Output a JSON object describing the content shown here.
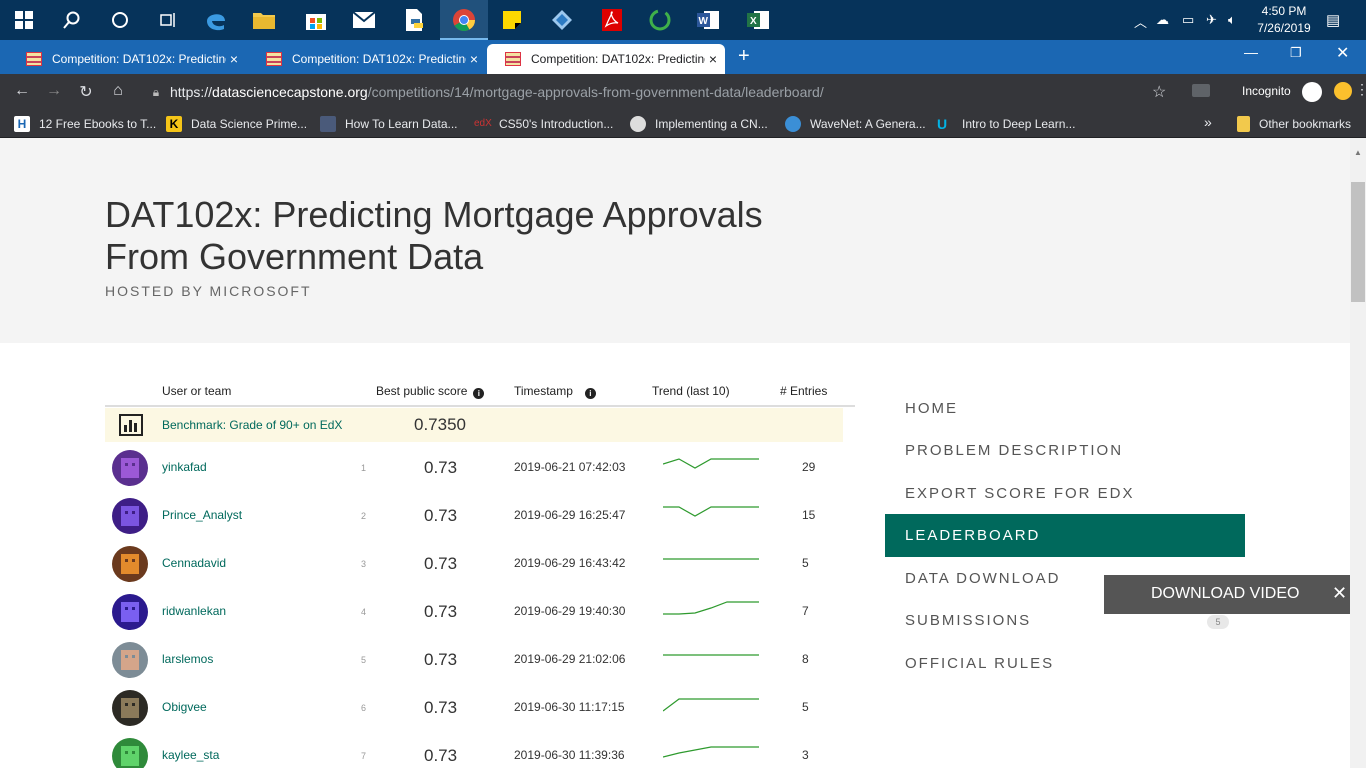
{
  "taskbar": {
    "time": "4:50 PM",
    "date": "7/26/2019"
  },
  "tabs": [
    {
      "title": "Competition: DAT102x: Predicting Mortgage Approvals",
      "close": "×"
    },
    {
      "title": "Competition: DAT102x: Predicting Mortgage Approvals",
      "close": "×"
    },
    {
      "title": "Competition: DAT102x: Predicting Mortgage Approvals",
      "close": "×"
    }
  ],
  "toolbar": {
    "new_tab": "+",
    "url_scheme": "https://",
    "url_host": "datasciencecapstone.org",
    "url_path": "/competitions/14/mortgage-approvals-from-government-data/leaderboard/",
    "incognito_label": "Incognito"
  },
  "bookmarks": {
    "items": [
      {
        "label": "12 Free Ebooks to T..."
      },
      {
        "label": "Data Science Prime..."
      },
      {
        "label": "How To Learn Data..."
      },
      {
        "label": "CS50's Introduction..."
      },
      {
        "label": "Implementing a CN..."
      },
      {
        "label": "WaveNet: A Genera..."
      },
      {
        "label": "Intro to Deep Learn..."
      }
    ],
    "overflow": "»",
    "other": "Other bookmarks"
  },
  "hero": {
    "title_line1": "DAT102x: Predicting Mortgage Approvals",
    "title_line2": "From Government Data",
    "hosted_by": "HOSTED BY MICROSOFT"
  },
  "leaderboard": {
    "columns": {
      "user": "User or team",
      "score": "Best public score",
      "timestamp": "Timestamp",
      "trend": "Trend (last 10)",
      "entries": "# Entries"
    },
    "benchmark": {
      "name": "Benchmark: Grade of 90+ on EdX",
      "score": "0.7350"
    },
    "rows": [
      {
        "rank": "1",
        "name": "yinkafad",
        "score": "0.73",
        "timestamp": "2019-06-21 07:42:03",
        "entries": "29",
        "trend": [
          0.55,
          0.35,
          0.7,
          0.35,
          0.35,
          0.35,
          0.35
        ]
      },
      {
        "rank": "2",
        "name": "Prince_Analyst",
        "score": "0.73",
        "timestamp": "2019-06-29 16:25:47",
        "entries": "15",
        "trend": [
          0.35,
          0.35,
          0.7,
          0.35,
          0.35,
          0.35,
          0.35
        ]
      },
      {
        "rank": "3",
        "name": "Cennadavid",
        "score": "0.73",
        "timestamp": "2019-06-29 16:43:42",
        "entries": "5",
        "trend": [
          0.5,
          0.5,
          0.5,
          0.5,
          0.5,
          0.5,
          0.5
        ]
      },
      {
        "rank": "4",
        "name": "ridwanlekan",
        "score": "0.73",
        "timestamp": "2019-06-29 19:40:30",
        "entries": "7",
        "trend": [
          0.8,
          0.8,
          0.75,
          0.55,
          0.3,
          0.3,
          0.3
        ]
      },
      {
        "rank": "5",
        "name": "larslemos",
        "score": "0.73",
        "timestamp": "2019-06-29 21:02:06",
        "entries": "8",
        "trend": [
          0.5,
          0.5,
          0.5,
          0.5,
          0.5,
          0.5,
          0.5
        ]
      },
      {
        "rank": "6",
        "name": "Obigvee",
        "score": "0.73",
        "timestamp": "2019-06-30 11:17:15",
        "entries": "5",
        "trend": [
          0.85,
          0.35,
          0.35,
          0.35,
          0.35,
          0.35,
          0.35
        ]
      },
      {
        "rank": "7",
        "name": "kaylee_sta",
        "score": "0.73",
        "timestamp": "2019-06-30 11:39:36",
        "entries": "3",
        "trend": [
          0.75,
          0.6,
          0.45,
          0.35,
          0.35,
          0.35,
          0.35
        ]
      }
    ]
  },
  "sidenav": {
    "items": [
      {
        "label": "HOME"
      },
      {
        "label": "PROBLEM DESCRIPTION"
      },
      {
        "label": "EXPORT SCORE FOR EDX"
      },
      {
        "label": "LEADERBOARD"
      },
      {
        "label": "DATA DOWNLOAD"
      },
      {
        "label": "SUBMISSIONS",
        "badge": "5"
      },
      {
        "label": "OFFICIAL RULES"
      }
    ]
  },
  "download_bar": {
    "label": "DOWNLOAD VIDEO",
    "close": "✕"
  },
  "colors": {
    "accent": "#00695c",
    "trend_line": "#2e9a2e",
    "benchmark_bg": "#fcf8e3",
    "tabstrip": "#1b67b3",
    "taskbar": "#06335a"
  }
}
